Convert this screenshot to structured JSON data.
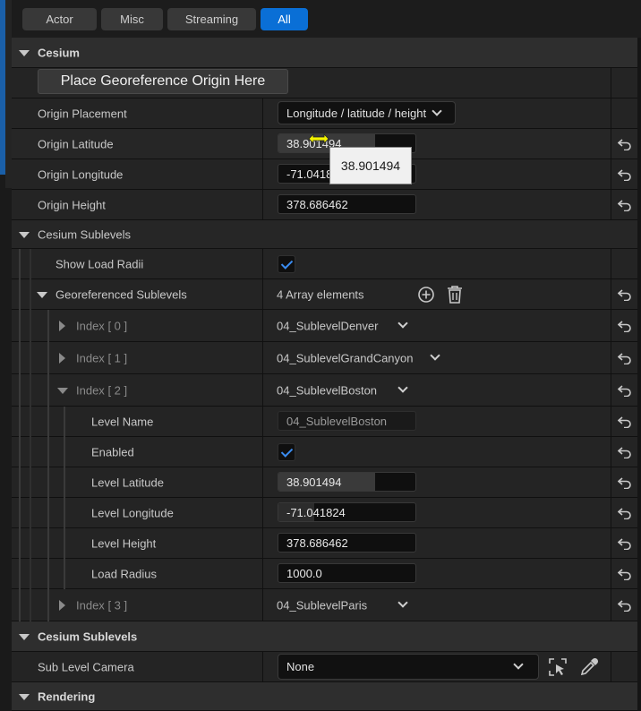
{
  "filters": {
    "actor": "Actor",
    "misc": "Misc",
    "streaming": "Streaming",
    "all": "All"
  },
  "cesium": {
    "title": "Cesium",
    "place_button": "Place Georeference Origin Here",
    "origin_placement": {
      "label": "Origin Placement",
      "value": "Longitude / latitude / height"
    },
    "origin_latitude": {
      "label": "Origin Latitude",
      "value": "38.901494",
      "tooltip": "38.901494"
    },
    "origin_longitude": {
      "label": "Origin Longitude",
      "value": "-71.0418"
    },
    "origin_height": {
      "label": "Origin Height",
      "value": "378.686462"
    }
  },
  "sublevels": {
    "title": "Cesium Sublevels",
    "show_load_radii": {
      "label": "Show Load Radii",
      "checked": true
    },
    "georef": {
      "label": "Georeferenced Sublevels",
      "count": "4 Array elements"
    },
    "items": [
      {
        "index_label": "Index",
        "index": "[ 0 ]",
        "value": "04_SublevelDenver"
      },
      {
        "index_label": "Index",
        "index": "[ 1 ]",
        "value": "04_SublevelGrandCanyon"
      },
      {
        "index_label": "Index",
        "index": "[ 2 ]",
        "value": "04_SublevelBoston"
      },
      {
        "index_label": "Index",
        "index": "[ 3 ]",
        "value": "04_SublevelParis"
      }
    ],
    "expanded": {
      "level_name": {
        "label": "Level Name",
        "value": "04_SublevelBoston"
      },
      "enabled": {
        "label": "Enabled",
        "checked": true
      },
      "level_latitude": {
        "label": "Level Latitude",
        "value": "38.901494"
      },
      "level_longitude": {
        "label": "Level Longitude",
        "value": "-71.041824"
      },
      "level_height": {
        "label": "Level Height",
        "value": "378.686462"
      },
      "load_radius": {
        "label": "Load Radius",
        "value": "1000.0"
      }
    }
  },
  "sublevels2": {
    "title": "Cesium Sublevels",
    "camera": {
      "label": "Sub Level Camera",
      "value": "None"
    }
  },
  "rendering": {
    "title": "Rendering"
  },
  "colors": {
    "accent": "#0a6fd6",
    "check": "#3a8cf0",
    "panel": "#242424"
  },
  "icons": [
    "reset-arrow-icon",
    "add-circle-icon",
    "trash-icon",
    "chevron-down-icon",
    "pick-actor-icon",
    "eyedropper-icon"
  ]
}
